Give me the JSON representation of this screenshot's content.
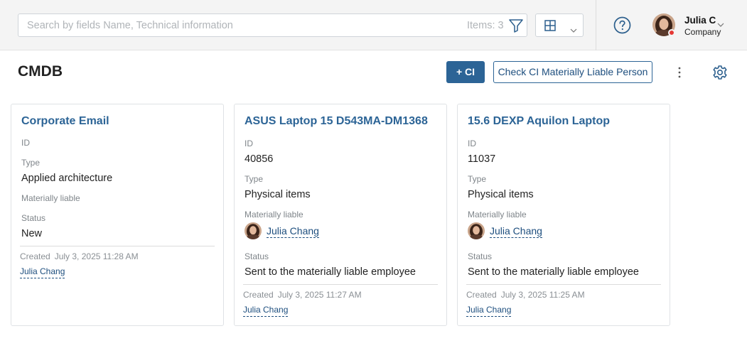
{
  "search": {
    "placeholder": "Search by fields Name, Technical information",
    "items_count": "Items: 3"
  },
  "user": {
    "name": "Julia C",
    "company": "Company"
  },
  "page": {
    "title": "CMDB",
    "add_button": "+ CI",
    "check_button": "Check CI Materially Liable Person"
  },
  "labels": {
    "id": "ID",
    "type": "Type",
    "materially_liable": "Materially liable",
    "status": "Status",
    "created": "Created"
  },
  "cards": [
    {
      "title": "Corporate Email",
      "id": "",
      "type": "Applied architecture",
      "materially_liable": "",
      "status": "New",
      "created_at": "July 3, 2025 11:28 AM",
      "created_by": "Julia Chang"
    },
    {
      "title": "ASUS Laptop 15 D543MA-DM1368",
      "id": "40856",
      "type": "Physical items",
      "materially_liable": "Julia Chang",
      "status": "Sent to the materially liable employee",
      "created_at": "July 3, 2025 11:27 AM",
      "created_by": "Julia Chang"
    },
    {
      "title": "15.6 DEXP Aquilon Laptop",
      "id": "11037",
      "type": "Physical items",
      "materially_liable": "Julia Chang",
      "status": "Sent to the materially liable employee",
      "created_at": "July 3, 2025 11:25 AM",
      "created_by": "Julia Chang"
    }
  ],
  "colors": {
    "accent": "#2c6496",
    "link": "#1d4e7e",
    "status_dot": "#e53935"
  },
  "icons": [
    "filter-icon",
    "grid-view-icon",
    "chevron-down-icon",
    "help-icon",
    "kebab-menu-icon",
    "gear-icon"
  ]
}
